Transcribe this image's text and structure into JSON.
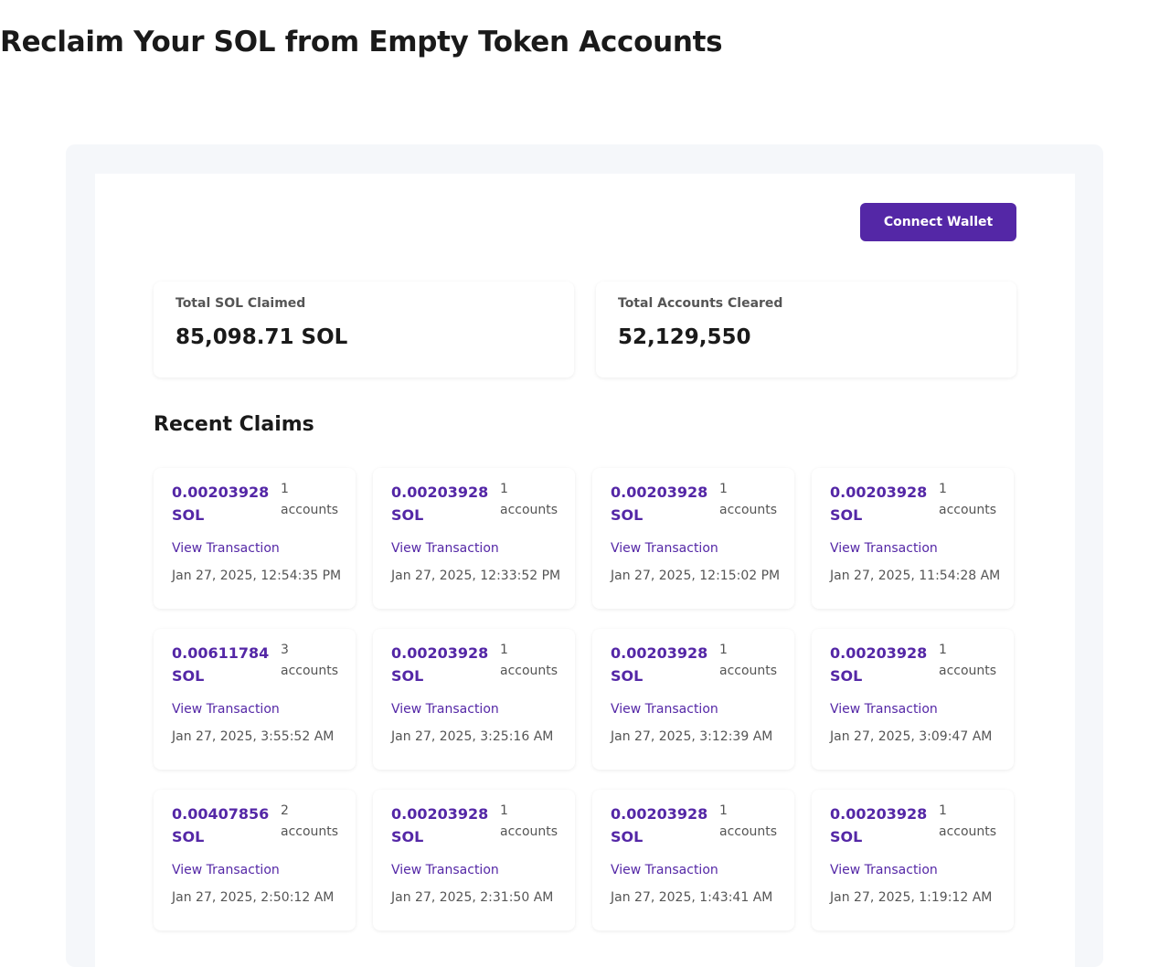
{
  "page": {
    "title": "Reclaim Your SOL from Empty Token Accounts"
  },
  "header": {
    "connect_wallet_label": "Connect Wallet"
  },
  "stats": {
    "total_sol_claimed": {
      "label": "Total SOL Claimed",
      "value": "85,098.71 SOL"
    },
    "total_accounts_cleared": {
      "label": "Total Accounts Cleared",
      "value": "52,129,550"
    }
  },
  "recent_claims": {
    "title": "Recent Claims",
    "link_label": "View Transaction",
    "items": [
      {
        "amount": "0.00203928",
        "unit": "SOL",
        "count": "1",
        "count_label": "accounts",
        "date": "Jan 27, 2025, 12:54:35 PM"
      },
      {
        "amount": "0.00203928",
        "unit": "SOL",
        "count": "1",
        "count_label": "accounts",
        "date": "Jan 27, 2025, 12:33:52 PM"
      },
      {
        "amount": "0.00203928",
        "unit": "SOL",
        "count": "1",
        "count_label": "accounts",
        "date": "Jan 27, 2025, 12:15:02 PM"
      },
      {
        "amount": "0.00203928",
        "unit": "SOL",
        "count": "1",
        "count_label": "accounts",
        "date": "Jan 27, 2025, 11:54:28 AM"
      },
      {
        "amount": "0.00611784",
        "unit": "SOL",
        "count": "3",
        "count_label": "accounts",
        "date": "Jan 27, 2025, 3:55:52 AM"
      },
      {
        "amount": "0.00203928",
        "unit": "SOL",
        "count": "1",
        "count_label": "accounts",
        "date": "Jan 27, 2025, 3:25:16 AM"
      },
      {
        "amount": "0.00203928",
        "unit": "SOL",
        "count": "1",
        "count_label": "accounts",
        "date": "Jan 27, 2025, 3:12:39 AM"
      },
      {
        "amount": "0.00203928",
        "unit": "SOL",
        "count": "1",
        "count_label": "accounts",
        "date": "Jan 27, 2025, 3:09:47 AM"
      },
      {
        "amount": "0.00407856",
        "unit": "SOL",
        "count": "2",
        "count_label": "accounts",
        "date": "Jan 27, 2025, 2:50:12 AM"
      },
      {
        "amount": "0.00203928",
        "unit": "SOL",
        "count": "1",
        "count_label": "accounts",
        "date": "Jan 27, 2025, 2:31:50 AM"
      },
      {
        "amount": "0.00203928",
        "unit": "SOL",
        "count": "1",
        "count_label": "accounts",
        "date": "Jan 27, 2025, 1:43:41 AM"
      },
      {
        "amount": "0.00203928",
        "unit": "SOL",
        "count": "1",
        "count_label": "accounts",
        "date": "Jan 27, 2025, 1:19:12 AM"
      }
    ]
  },
  "colors": {
    "accent": "#5427a6",
    "panel_background": "#f5f7fa",
    "muted_text": "#555555"
  }
}
